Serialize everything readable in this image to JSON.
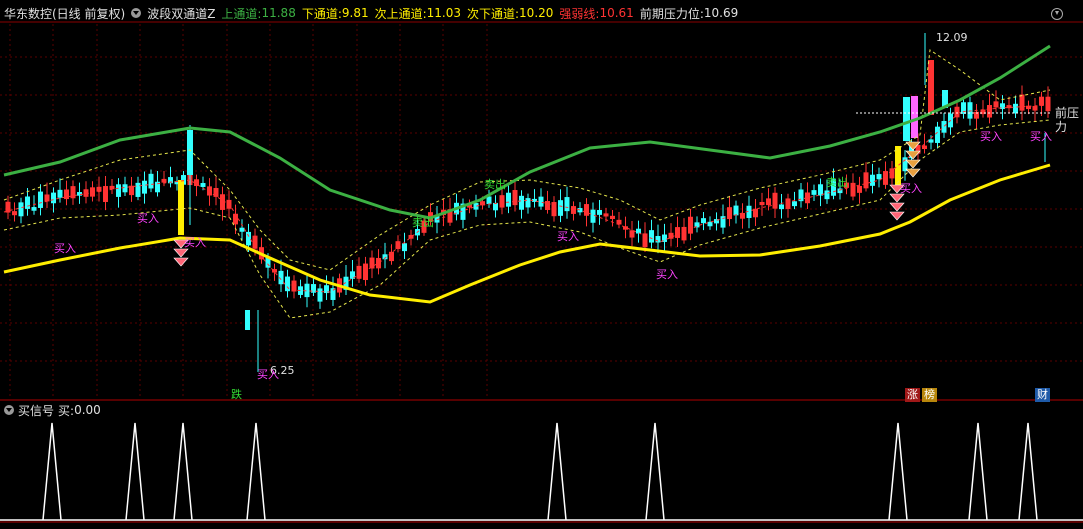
{
  "header": {
    "stock_name": "华东数控(日线 前复权)",
    "indicator": "波段双通道Z",
    "upper_label": "上通道:",
    "upper_value": "11.88",
    "lower_label": "下通道:",
    "lower_value": "9.81",
    "sub_upper_label": "次上通道:",
    "sub_upper_value": "11.03",
    "sub_lower_label": "次下通道:",
    "sub_lower_value": "10.20",
    "strength_label": "强弱线:",
    "strength_value": "10.61",
    "resistance_label": "前期压力位:",
    "resistance_value": "10.69"
  },
  "sub_panel": {
    "title": "买信号",
    "value_label": "买:",
    "value": "0.00"
  },
  "annotations": {
    "high_price": "12.09",
    "low_price": "6.25",
    "resistance_tag": "前压力",
    "buy": "买入",
    "sell": "卖出"
  },
  "markers": {
    "fall": "跌",
    "rise": "涨",
    "list": "榜",
    "finance": "财"
  },
  "colors": {
    "up": "#ff3333",
    "down": "#33ffff",
    "upper_channel": "#3cb043",
    "lower_channel": "#ffee00",
    "sub_channel": "#e6e64c",
    "strength": "#ff3333",
    "buy_text": "#ff44ff",
    "sell_text": "#33dd33",
    "signal": "#ffffff"
  },
  "chart_data": {
    "type": "candlestick",
    "y_range_main": [
      5.5,
      12.5
    ],
    "series": [
      {
        "name": "上通道",
        "values": [
          9.9,
          10.1,
          10.3,
          10.6,
          10.85,
          10.95,
          10.7,
          10.2,
          9.5,
          8.9,
          8.6,
          8.85,
          9.3,
          9.7,
          10.1,
          10.2,
          10.05,
          10.25,
          10.45,
          10.6,
          10.65,
          10.85,
          11.3,
          11.6,
          11.88
        ]
      },
      {
        "name": "下通道",
        "values": [
          7.4,
          7.7,
          8.0,
          8.15,
          8.3,
          8.3,
          8.0,
          7.5,
          7.05,
          6.8,
          6.85,
          7.2,
          7.55,
          7.85,
          8.05,
          8.05,
          7.95,
          7.9,
          8.0,
          8.05,
          8.25,
          8.6,
          9.2,
          9.6,
          9.81
        ]
      }
    ],
    "signal_peaks": [
      1,
      1,
      1,
      1,
      1,
      1,
      1,
      1,
      1
    ]
  }
}
